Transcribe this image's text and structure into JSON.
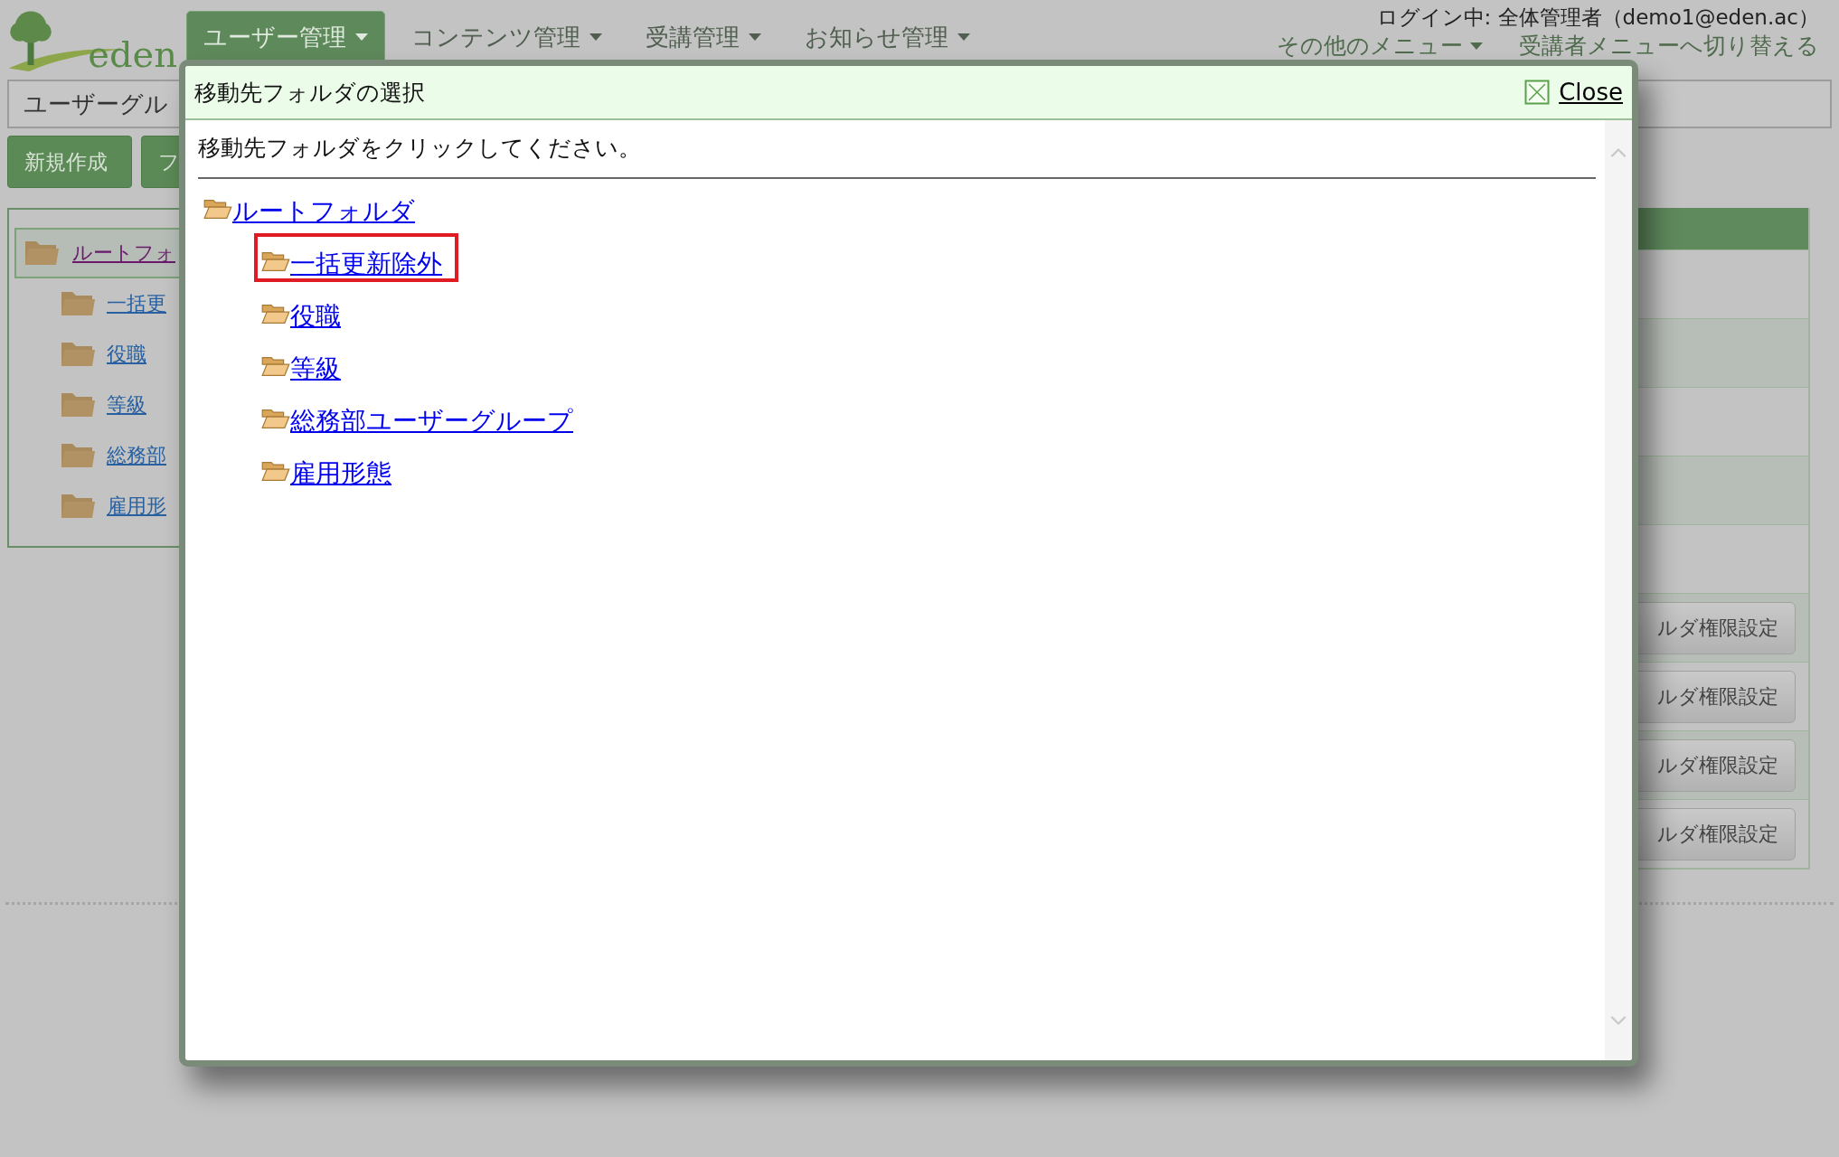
{
  "logo": {
    "text": "eden"
  },
  "nav": [
    {
      "label": "ユーザー管理",
      "selected": true
    },
    {
      "label": "コンテンツ管理",
      "selected": false
    },
    {
      "label": "受講管理",
      "selected": false
    },
    {
      "label": "お知らせ管理",
      "selected": false
    }
  ],
  "login_status": "ログイン中: 全体管理者（demo1@eden.ac）",
  "header_links": [
    {
      "label": "その他のメニュー",
      "kind": "dropdown"
    },
    {
      "label": "受講者メニューへ切り替える",
      "kind": "link"
    }
  ],
  "group_field": {
    "value": "ユーザーグル"
  },
  "toolbar_buttons": [
    "新規作成",
    "フ"
  ],
  "folder_tree": {
    "label": "ルートフォ",
    "selected": true,
    "children": [
      {
        "label": "一括更",
        "selected": false
      },
      {
        "label": "役職",
        "selected": false
      },
      {
        "label": "等級",
        "selected": false
      },
      {
        "label": "総務部",
        "selected": false
      },
      {
        "label": "雇用形",
        "selected": false
      }
    ]
  },
  "table": {
    "rows": [
      {
        "kind": "empty"
      },
      {
        "kind": "empty"
      },
      {
        "kind": "empty"
      },
      {
        "kind": "empty"
      },
      {
        "kind": "empty"
      },
      {
        "kind": "button",
        "button": "ルダ権限設定"
      },
      {
        "kind": "button",
        "button": "ルダ権限設定"
      },
      {
        "kind": "button",
        "button": "ルダ権限設定"
      },
      {
        "kind": "button",
        "button": "ルダ権限設定"
      }
    ]
  },
  "dialog": {
    "title": "移動先フォルダの選択",
    "close": "Close",
    "instruction": "移動先フォルダをクリックしてください。",
    "tree": {
      "label": "ルートフォルダ",
      "selected": false,
      "children": [
        {
          "label": "一括更新除外",
          "selected": true
        },
        {
          "label": "役職",
          "selected": false
        },
        {
          "label": "等級",
          "selected": false
        },
        {
          "label": "総務部ユーザーグループ",
          "selected": false
        },
        {
          "label": "雇用形態",
          "selected": false
        }
      ]
    }
  }
}
